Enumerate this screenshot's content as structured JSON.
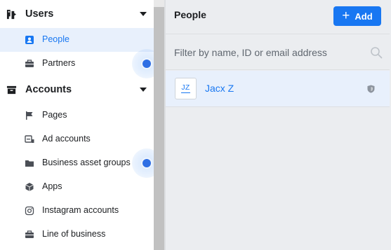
{
  "sidebar": {
    "sections": [
      {
        "label": "Users",
        "icon": "users-icon",
        "items": [
          {
            "label": "People",
            "icon": "person-badge-icon",
            "active": true
          },
          {
            "label": "Partners",
            "icon": "briefcase-icon",
            "active": false
          }
        ]
      },
      {
        "label": "Accounts",
        "icon": "accounts-icon",
        "items": [
          {
            "label": "Pages",
            "icon": "flag-icon",
            "active": false
          },
          {
            "label": "Ad accounts",
            "icon": "ad-account-icon",
            "active": false
          },
          {
            "label": "Business asset groups",
            "icon": "folder-icon",
            "active": false
          },
          {
            "label": "Apps",
            "icon": "cube-icon",
            "active": false
          },
          {
            "label": "Instagram accounts",
            "icon": "instagram-icon",
            "active": false
          },
          {
            "label": "Line of business",
            "icon": "briefcase-icon",
            "active": false
          }
        ]
      }
    ]
  },
  "panel": {
    "title": "People",
    "add_label": "Add",
    "search_placeholder": "Filter by name, ID or email address",
    "people": [
      {
        "initials": "JZ",
        "name": "Jacx Z",
        "role_icon": "shield-icon"
      }
    ]
  },
  "colors": {
    "accent": "#1877f2",
    "selected_bg": "#e8f0fc",
    "panel_bg": "#ebedf0"
  }
}
